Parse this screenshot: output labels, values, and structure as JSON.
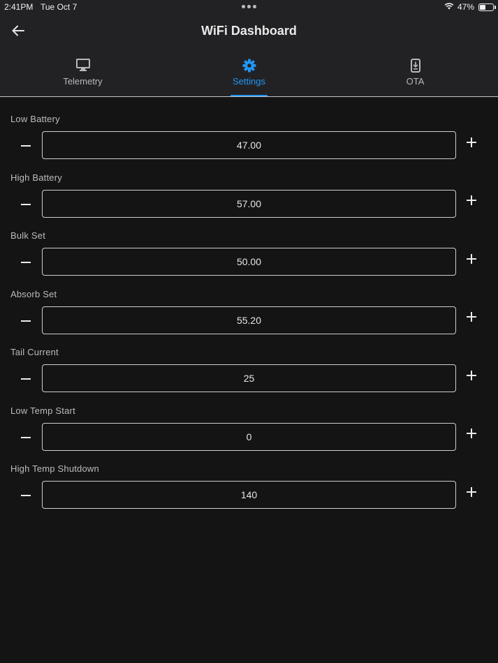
{
  "status_bar": {
    "time": "2:41PM",
    "date": "Tue Oct 7",
    "battery_percent": "47%",
    "battery_level": 0.47,
    "icons": [
      "more-dots-icon",
      "wifi-icon",
      "battery-icon"
    ]
  },
  "app_bar": {
    "title": "WiFi Dashboard",
    "back_icon": "arrow-left-icon"
  },
  "tabs": [
    {
      "label": "Telemetry",
      "icon": "monitor-icon",
      "active": false
    },
    {
      "label": "Settings",
      "icon": "gear-icon",
      "active": true
    },
    {
      "label": "OTA",
      "icon": "phone-download-icon",
      "active": false
    }
  ],
  "colors": {
    "accent": "#2196f3",
    "background": "#141414",
    "bar_background": "#222224"
  },
  "settings": [
    {
      "label": "Low Battery",
      "value": "47.00"
    },
    {
      "label": "High Battery",
      "value": "57.00"
    },
    {
      "label": "Bulk Set",
      "value": "50.00"
    },
    {
      "label": "Absorb Set",
      "value": "55.20"
    },
    {
      "label": "Tail Current",
      "value": "25"
    },
    {
      "label": "Low Temp Start",
      "value": "0"
    },
    {
      "label": "High Temp Shutdown",
      "value": "140"
    }
  ]
}
